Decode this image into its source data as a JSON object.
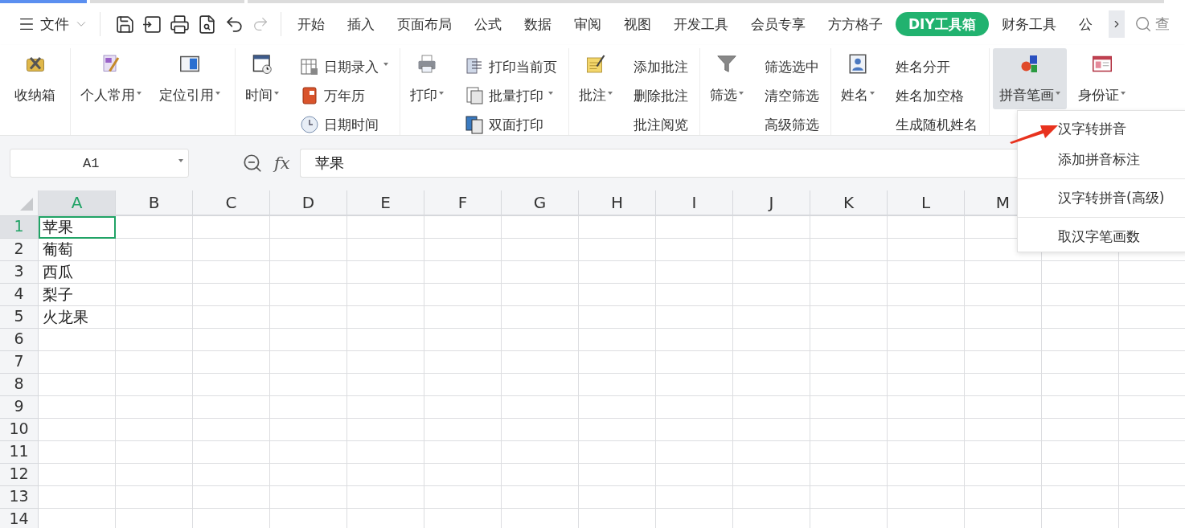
{
  "menu_bar": {
    "file_label": "文件",
    "tabs": [
      {
        "label": "开始",
        "selected": false
      },
      {
        "label": "插入",
        "selected": false
      },
      {
        "label": "页面布局",
        "selected": false
      },
      {
        "label": "公式",
        "selected": false
      },
      {
        "label": "数据",
        "selected": false
      },
      {
        "label": "审阅",
        "selected": false
      },
      {
        "label": "视图",
        "selected": false
      },
      {
        "label": "开发工具",
        "selected": false
      },
      {
        "label": "会员专享",
        "selected": false
      },
      {
        "label": "方方格子",
        "selected": false
      },
      {
        "label": "DIY工具箱",
        "selected": true
      },
      {
        "label": "财务工具",
        "selected": false
      },
      {
        "label": "公",
        "selected": false
      }
    ],
    "search": {
      "placeholder": "查"
    }
  },
  "ribbon": {
    "groups": [
      {
        "items": [
          {
            "kind": "large",
            "label": "收纳箱",
            "dropdown": false,
            "expanded": false
          }
        ]
      },
      {
        "items": [
          {
            "kind": "large",
            "label": "个人常用",
            "dropdown": true,
            "expanded": false
          },
          {
            "kind": "large",
            "label": "定位引用",
            "dropdown": true,
            "expanded": false
          }
        ]
      },
      {
        "items": [
          {
            "kind": "large",
            "label": "时间",
            "dropdown": true,
            "expanded": false
          },
          {
            "kind": "icon-list",
            "entries": [
              {
                "label": "日期录入",
                "dropdown": true
              },
              {
                "label": "万年历",
                "dropdown": false
              },
              {
                "label": "日期时间",
                "dropdown": false
              }
            ]
          }
        ]
      },
      {
        "items": [
          {
            "kind": "large",
            "label": "打印",
            "dropdown": true,
            "expanded": false
          },
          {
            "kind": "icon-list",
            "entries": [
              {
                "label": "打印当前页",
                "dropdown": false
              },
              {
                "label": "批量打印",
                "dropdown": true
              },
              {
                "label": "双面打印",
                "dropdown": false
              }
            ]
          }
        ]
      },
      {
        "items": [
          {
            "kind": "large",
            "label": "批注",
            "dropdown": true,
            "expanded": false
          },
          {
            "kind": "text-list",
            "entries": [
              {
                "label": "添加批注",
                "dropdown": false
              },
              {
                "label": "删除批注",
                "dropdown": false
              },
              {
                "label": "批注阅览",
                "dropdown": false
              }
            ]
          }
        ]
      },
      {
        "items": [
          {
            "kind": "large",
            "label": "筛选",
            "dropdown": true,
            "expanded": false
          },
          {
            "kind": "text-list",
            "entries": [
              {
                "label": "筛选选中",
                "dropdown": false
              },
              {
                "label": "清空筛选",
                "dropdown": false
              },
              {
                "label": "高级筛选",
                "dropdown": false
              }
            ]
          }
        ]
      },
      {
        "items": [
          {
            "kind": "large",
            "label": "姓名",
            "dropdown": true,
            "expanded": false
          },
          {
            "kind": "text-list",
            "entries": [
              {
                "label": "姓名分开",
                "dropdown": false
              },
              {
                "label": "姓名加空格",
                "dropdown": false
              },
              {
                "label": "生成随机姓名",
                "dropdown": false
              }
            ]
          }
        ]
      },
      {
        "items": [
          {
            "kind": "large",
            "label": "拼音笔画",
            "dropdown": true,
            "expanded": true
          },
          {
            "kind": "large",
            "label": "身份证",
            "dropdown": true,
            "expanded": false
          }
        ]
      }
    ]
  },
  "dropdown_menu": {
    "groups": [
      [
        "汉字转拼音",
        "添加拼音标注"
      ],
      [
        "汉字转拼音(高级)"
      ],
      [
        "取汉字笔画数"
      ]
    ]
  },
  "formula_bar": {
    "name_box": "A1",
    "function_label": "fx",
    "formula": "苹果"
  },
  "sheet": {
    "columns": [
      {
        "label": "A",
        "selected": true
      },
      {
        "label": "B",
        "selected": false
      },
      {
        "label": "C",
        "selected": false
      },
      {
        "label": "D",
        "selected": false
      },
      {
        "label": "E",
        "selected": false
      },
      {
        "label": "F",
        "selected": false
      },
      {
        "label": "G",
        "selected": false
      },
      {
        "label": "H",
        "selected": false
      },
      {
        "label": "I",
        "selected": false
      },
      {
        "label": "J",
        "selected": false
      },
      {
        "label": "K",
        "selected": false
      },
      {
        "label": "L",
        "selected": false
      },
      {
        "label": "M",
        "selected": false
      }
    ],
    "rows": [
      {
        "label": "1",
        "selected": true,
        "cells": [
          "苹果"
        ]
      },
      {
        "label": "2",
        "selected": false,
        "cells": [
          "葡萄"
        ]
      },
      {
        "label": "3",
        "selected": false,
        "cells": [
          "西瓜"
        ]
      },
      {
        "label": "4",
        "selected": false,
        "cells": [
          "梨子"
        ]
      },
      {
        "label": "5",
        "selected": false,
        "cells": [
          "火龙果"
        ]
      },
      {
        "label": "6",
        "selected": false,
        "cells": []
      },
      {
        "label": "7",
        "selected": false,
        "cells": []
      },
      {
        "label": "8",
        "selected": false,
        "cells": []
      },
      {
        "label": "9",
        "selected": false,
        "cells": []
      },
      {
        "label": "10",
        "selected": false,
        "cells": []
      },
      {
        "label": "11",
        "selected": false,
        "cells": []
      },
      {
        "label": "12",
        "selected": false,
        "cells": []
      },
      {
        "label": "13",
        "selected": false,
        "cells": []
      },
      {
        "label": "14",
        "selected": false,
        "cells": []
      }
    ]
  }
}
